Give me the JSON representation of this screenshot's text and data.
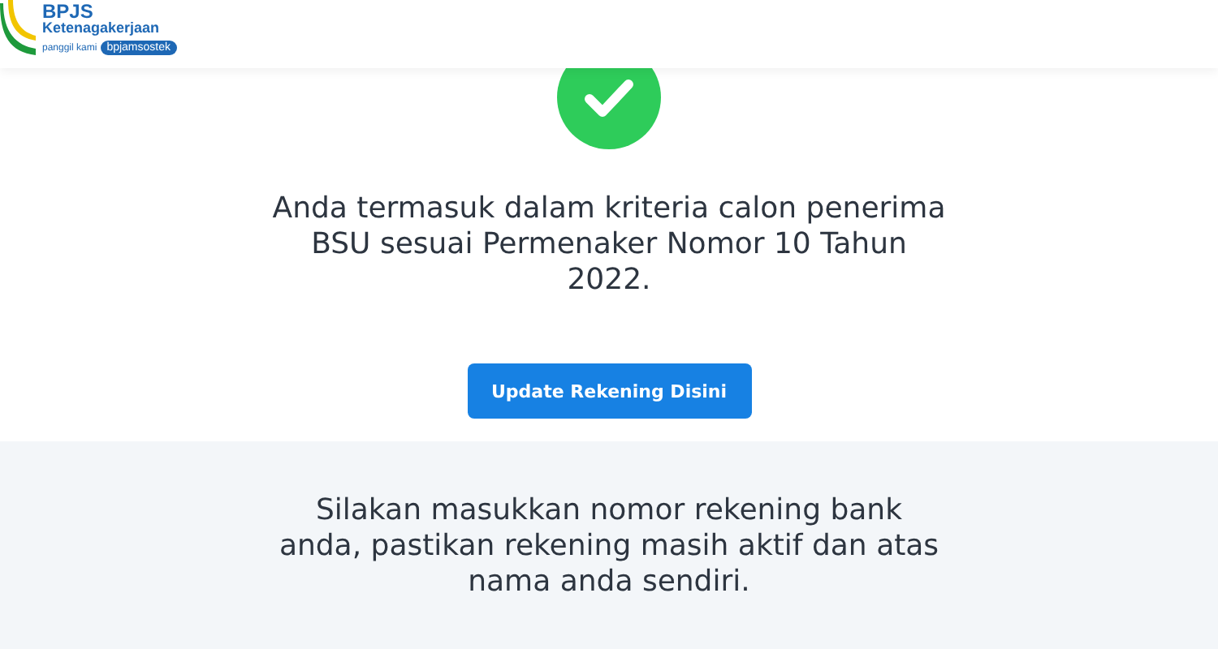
{
  "header": {
    "logo": {
      "name": "BPJS",
      "subtitle": "Ketenagakerjaan",
      "tagline": "panggil kami",
      "badge": "bpjamsostek"
    }
  },
  "result": {
    "message": "Anda termasuk dalam kriteria calon penerima BSU sesuai Permenaker Nomor 10 Tahun 2022.",
    "button": "Update Rekening Disini"
  },
  "info": {
    "message": "Silakan masukkan nomor rekening bank anda, pastikan rekening masih aktif dan atas nama anda sendiri."
  }
}
